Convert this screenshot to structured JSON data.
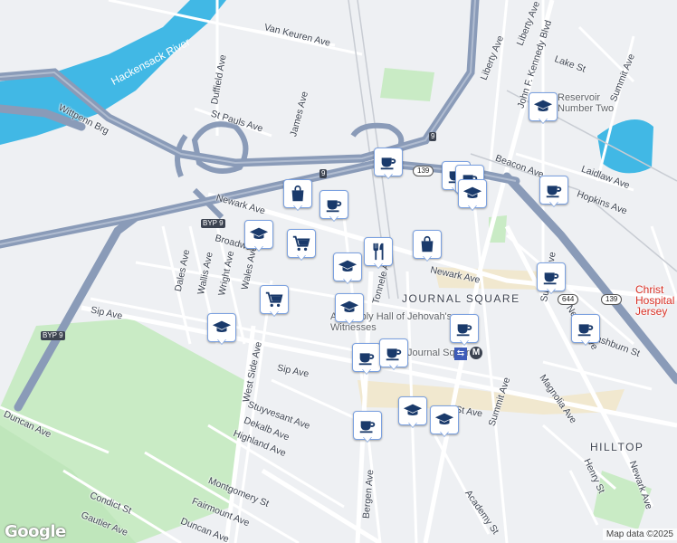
{
  "map": {
    "water_labels": [
      "Hackensack River"
    ],
    "street_labels": [
      "Van Keuren Ave",
      "Duffield Ave",
      "James Ave",
      "St Pauls Ave",
      "Wittpenn Brg",
      "Newark Ave",
      "Broadway",
      "Dales Ave",
      "Wallis Ave",
      "Wright Ave",
      "Wales Ave",
      "Sip Ave",
      "West Side Ave",
      "Stuyvesant Ave",
      "Dekalb Ave",
      "Highland Ave",
      "Duncan Ave",
      "Montgomery St",
      "Fairmount Ave",
      "Condict St",
      "Gautier Ave",
      "Liberty Ave",
      "Lake St",
      "John F. Kennedy Blvd",
      "Summit Ave",
      "Beacon Ave",
      "Laidlaw Ave",
      "Hopkins Ave",
      "Washburn St",
      "Magnolia Ave",
      "Henry St",
      "Bergen Ave",
      "Academy St",
      "Tonnele Ave",
      "St Ave",
      "Liberty Ave"
    ],
    "neighborhoods": [
      "JOURNAL SQUARE",
      "HILLTOP"
    ],
    "poi_labels": [
      "Reservoir Number Two",
      "Assembly Hall of Jehovah's Witnesses",
      "Journal Square",
      "Christ Hospital Jersey"
    ],
    "route_shields": [
      "9",
      "9",
      "139",
      "BYP 9",
      "BYP 9",
      "644",
      "139"
    ],
    "metro_badge": "M",
    "markers": [
      {
        "type": "coffee",
        "name": "coffee-marker-1"
      },
      {
        "type": "shopping-bag",
        "name": "shopping-marker-1"
      },
      {
        "type": "coffee",
        "name": "coffee-marker-2"
      },
      {
        "type": "school",
        "name": "school-marker-1"
      },
      {
        "type": "grocery",
        "name": "grocery-marker-1"
      },
      {
        "type": "restaurant",
        "name": "restaurant-marker-1"
      },
      {
        "type": "shopping-bag",
        "name": "shopping-marker-2"
      },
      {
        "type": "school",
        "name": "school-marker-2"
      },
      {
        "type": "grocery",
        "name": "grocery-marker-2"
      },
      {
        "type": "school",
        "name": "school-marker-3"
      },
      {
        "type": "school",
        "name": "school-marker-4"
      },
      {
        "type": "coffee",
        "name": "coffee-marker-3"
      },
      {
        "type": "coffee",
        "name": "coffee-marker-4"
      },
      {
        "type": "coffee",
        "name": "coffee-marker-5"
      },
      {
        "type": "coffee",
        "name": "coffee-marker-6"
      },
      {
        "type": "coffee",
        "name": "coffee-marker-7"
      },
      {
        "type": "school",
        "name": "school-marker-5"
      },
      {
        "type": "coffee",
        "name": "coffee-marker-8"
      },
      {
        "type": "school",
        "name": "school-marker-6"
      },
      {
        "type": "school",
        "name": "school-marker-7"
      },
      {
        "type": "coffee",
        "name": "coffee-marker-9"
      },
      {
        "type": "coffee",
        "name": "coffee-marker-10"
      },
      {
        "type": "coffee",
        "name": "coffee-marker-11"
      },
      {
        "type": "school",
        "name": "school-marker-8"
      }
    ],
    "colors": {
      "water": "#41b8e5",
      "highway": "#8a9bb8",
      "park": "#c9ebc5",
      "marker_icon": "#1a3a6b",
      "marker_border": "#7ba1e0"
    }
  },
  "footer": {
    "logo": "Google",
    "attribution": "Map data ©2025"
  }
}
